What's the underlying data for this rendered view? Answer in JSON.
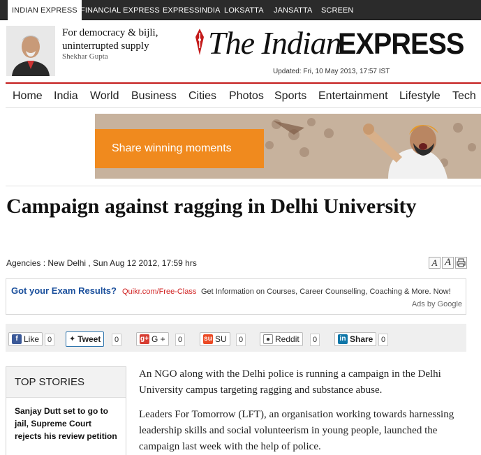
{
  "network_tabs": [
    "INDIAN EXPRESS",
    "FINANCIAL EXPRESS",
    "EXPRESSINDIA",
    "LOKSATTA",
    "JANSATTA",
    "SCREEN"
  ],
  "columnist": {
    "title": "For democracy & bijli, uninterrupted supply",
    "author": "Shekhar Gupta"
  },
  "logo": {
    "part1": "The Indian",
    "part2": "EXPRESS"
  },
  "updated": "Updated: Fri, 10 May 2013, 17:57 IST",
  "nav": [
    "Home",
    "India",
    "World",
    "Business",
    "Cities",
    "Photos",
    "Sports",
    "Entertainment",
    "Lifestyle",
    "Tech"
  ],
  "banner": {
    "cta": "Share winning moments"
  },
  "article": {
    "headline": "Campaign against ragging in Delhi University",
    "byline": "Agencies : New Delhi , Sun Aug 12 2012, 17:59 hrs",
    "paragraphs": [
      "An NGO along with the Delhi police is running a campaign in the Delhi University campus targeting ragging and substance abuse.",
      "Leaders For Tomorrow (LFT), an organisation working towards harnessing leadership skills and social volunteerism in young people, launched the campaign last week with the help of police."
    ]
  },
  "tools": {
    "font_smaller": "A",
    "font_larger": "A"
  },
  "ad": {
    "headline": "Got your Exam Results?",
    "url": "Quikr.com/Free-Class",
    "desc": "Get Information on Courses, Career  Counselling, Coaching & More. Now!",
    "attribution": "Ads by Google"
  },
  "share": {
    "like": {
      "label": "Like",
      "count": "0"
    },
    "tweet": {
      "label": "Tweet",
      "count": "0"
    },
    "gplus": {
      "label": "G +",
      "count": "0"
    },
    "su": {
      "label": "SU",
      "count": "0"
    },
    "reddit": {
      "label": "Reddit",
      "count": "0"
    },
    "linkedin": {
      "label": "Share",
      "count": "0"
    }
  },
  "top_stories": {
    "heading": "TOP STORIES",
    "items": [
      "Sanjay Dutt set to go to jail, Supreme Court rejects his review petition"
    ]
  },
  "colors": {
    "accent_red": "#c41b1b",
    "cta_orange": "#f08a1e",
    "ad_link_blue": "#1a4f9c"
  }
}
